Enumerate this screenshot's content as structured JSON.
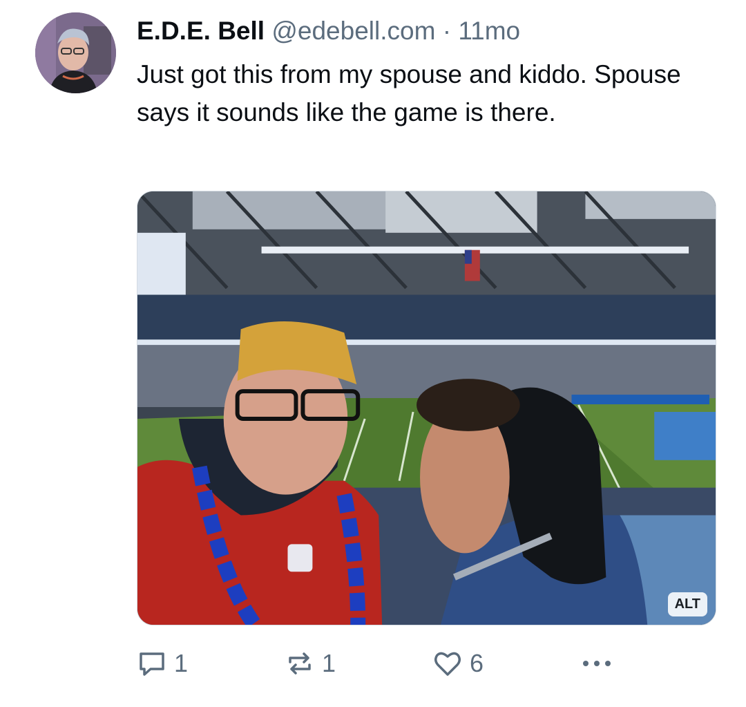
{
  "post": {
    "author": {
      "display_name": "E.D.E. Bell",
      "handle": "@edebell.com",
      "separator": "·",
      "time_ago": "11mo"
    },
    "text": "Just got this from my spouse and kiddo. Spouse says it sounds like the game is there.",
    "media": {
      "alt_badge": "ALT"
    },
    "actions": {
      "reply_count": "1",
      "repost_count": "1",
      "like_count": "6"
    }
  },
  "icons": {
    "reply": "reply-icon",
    "repost": "repost-icon",
    "like": "heart-icon",
    "more": "more-icon"
  },
  "colors": {
    "text_primary": "#0b0f14",
    "text_secondary": "#5b6c7d",
    "border": "#d4dbe2"
  }
}
